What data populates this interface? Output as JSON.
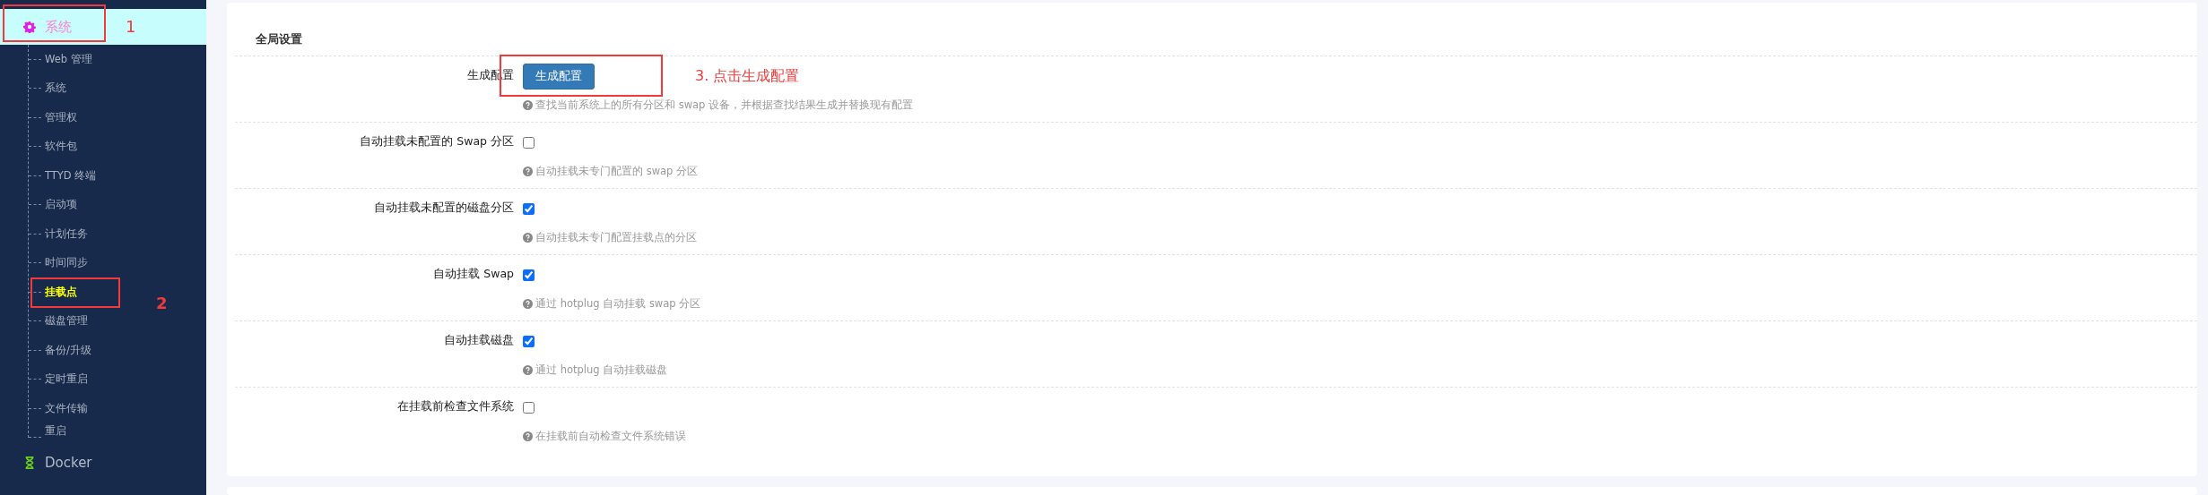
{
  "sidebar": {
    "items": [
      {
        "label": "系统",
        "selected": true,
        "annotation": "1",
        "children": [
          {
            "label": "Web 管理",
            "selected": false
          },
          {
            "label": "系统",
            "selected": false
          },
          {
            "label": "管理权",
            "selected": false
          },
          {
            "label": "软件包",
            "selected": false
          },
          {
            "label": "TTYD 终端",
            "selected": false
          },
          {
            "label": "启动项",
            "selected": false
          },
          {
            "label": "计划任务",
            "selected": false
          },
          {
            "label": "时间同步",
            "selected": false
          },
          {
            "label": "挂载点",
            "selected": true,
            "annotation": "2"
          },
          {
            "label": "磁盘管理",
            "selected": false
          },
          {
            "label": "备份/升级",
            "selected": false
          },
          {
            "label": "定时重启",
            "selected": false
          },
          {
            "label": "文件传输",
            "selected": false
          },
          {
            "label": "重启",
            "selected": false
          }
        ]
      },
      {
        "label": "Docker",
        "selected": false
      }
    ]
  },
  "section": {
    "title": "全局设置",
    "rows": [
      {
        "kind": "button",
        "label": "生成配置",
        "button": "生成配置",
        "description": "查找当前系统上的所有分区和 swap 设备，并根据查找结果生成并替换现有配置",
        "annotation": "3. 点击生成配置"
      },
      {
        "kind": "checkbox",
        "label": "自动挂载未配置的 Swap 分区",
        "checked": false,
        "description": "自动挂载未专门配置的 swap 分区"
      },
      {
        "kind": "checkbox",
        "label": "自动挂载未配置的磁盘分区",
        "checked": true,
        "description": "自动挂载未专门配置挂载点的分区"
      },
      {
        "kind": "checkbox",
        "label": "自动挂载 Swap",
        "checked": true,
        "description": "通过 hotplug 自动挂载 swap 分区"
      },
      {
        "kind": "checkbox",
        "label": "自动挂载磁盘",
        "checked": true,
        "description": "通过 hotplug 自动挂载磁盘"
      },
      {
        "kind": "checkbox",
        "label": "在挂载前检查文件系统",
        "checked": false,
        "description": "在挂载前自动检查文件系统错误"
      }
    ]
  }
}
